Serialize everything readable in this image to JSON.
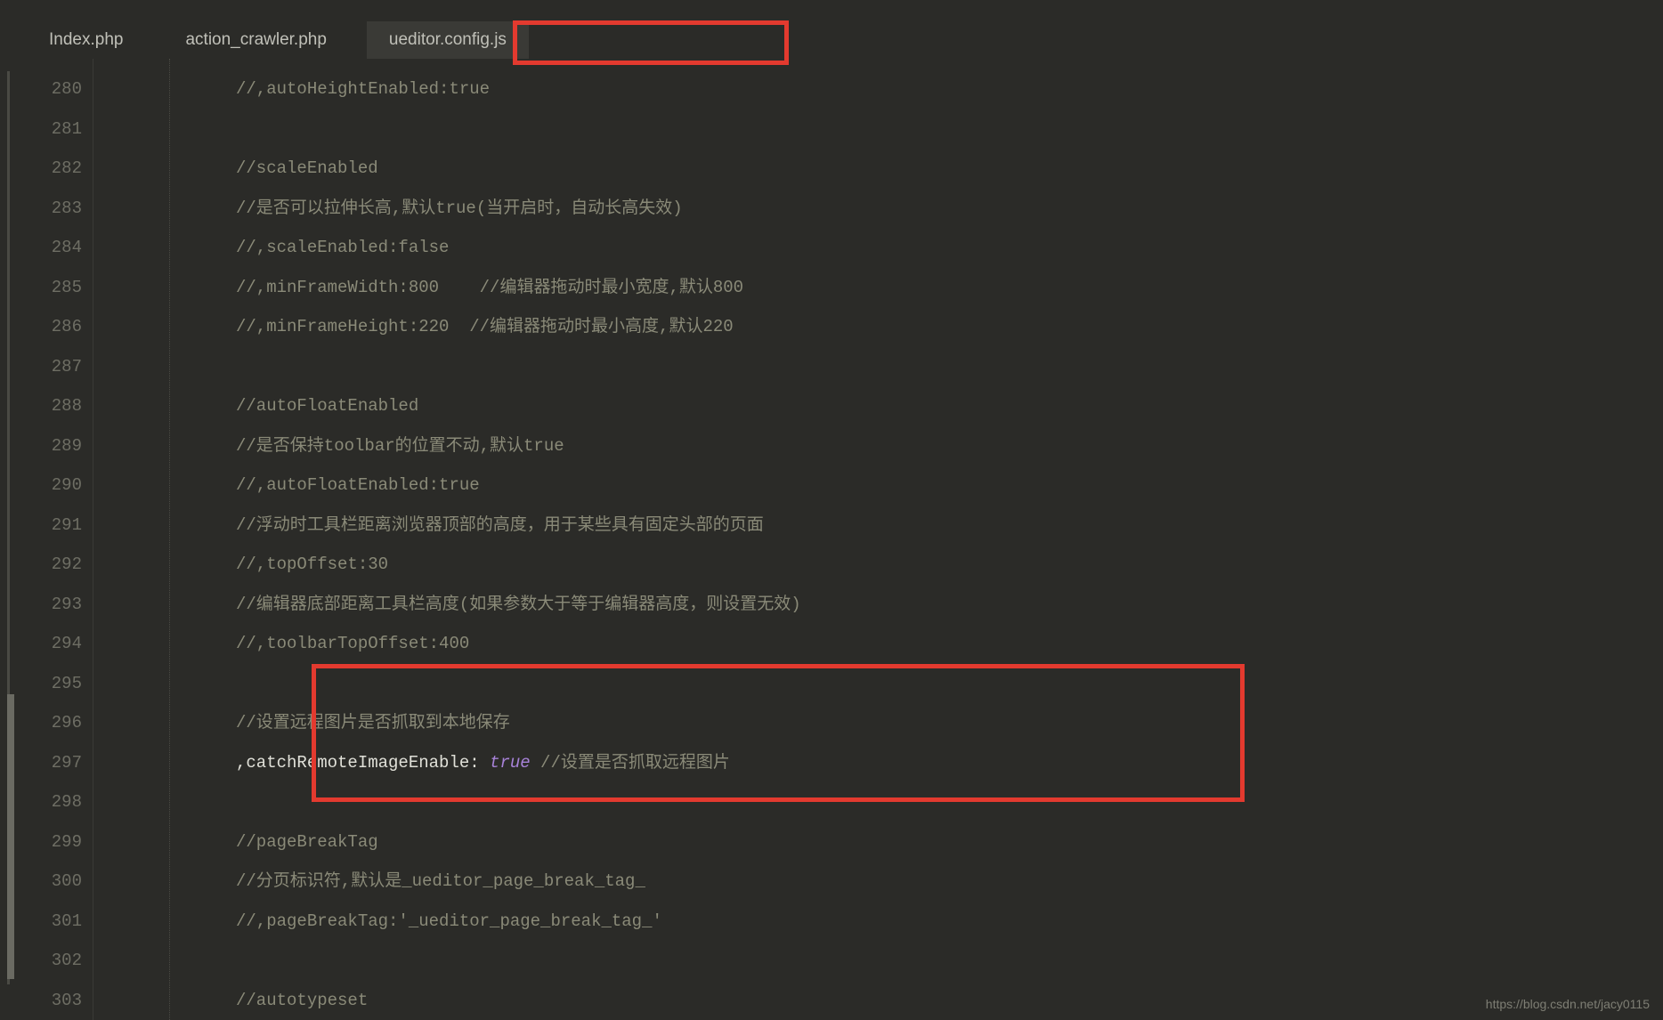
{
  "tabs": [
    {
      "label": "Index.php",
      "active": false
    },
    {
      "label": "action_crawler.php",
      "active": false
    },
    {
      "label": "ueditor.config.js",
      "active": true
    }
  ],
  "lines": [
    {
      "num": "280",
      "segments": [
        {
          "cls": "comment",
          "text": "//,autoHeightEnabled:true"
        }
      ]
    },
    {
      "num": "281",
      "segments": []
    },
    {
      "num": "282",
      "segments": [
        {
          "cls": "comment",
          "text": "//scaleEnabled"
        }
      ]
    },
    {
      "num": "283",
      "segments": [
        {
          "cls": "comment",
          "text": "//是否可以拉伸长高,默认true(当开启时，自动长高失效)"
        }
      ]
    },
    {
      "num": "284",
      "segments": [
        {
          "cls": "comment",
          "text": "//,scaleEnabled:false"
        }
      ]
    },
    {
      "num": "285",
      "segments": [
        {
          "cls": "comment",
          "text": "//,minFrameWidth:800    //编辑器拖动时最小宽度,默认800"
        }
      ]
    },
    {
      "num": "286",
      "segments": [
        {
          "cls": "comment",
          "text": "//,minFrameHeight:220  //编辑器拖动时最小高度,默认220"
        }
      ]
    },
    {
      "num": "287",
      "segments": []
    },
    {
      "num": "288",
      "segments": [
        {
          "cls": "comment",
          "text": "//autoFloatEnabled"
        }
      ]
    },
    {
      "num": "289",
      "segments": [
        {
          "cls": "comment",
          "text": "//是否保持toolbar的位置不动,默认true"
        }
      ]
    },
    {
      "num": "290",
      "segments": [
        {
          "cls": "comment",
          "text": "//,autoFloatEnabled:true"
        }
      ]
    },
    {
      "num": "291",
      "segments": [
        {
          "cls": "comment",
          "text": "//浮动时工具栏距离浏览器顶部的高度，用于某些具有固定头部的页面"
        }
      ]
    },
    {
      "num": "292",
      "segments": [
        {
          "cls": "comment",
          "text": "//,topOffset:30"
        }
      ]
    },
    {
      "num": "293",
      "segments": [
        {
          "cls": "comment",
          "text": "//编辑器底部距离工具栏高度(如果参数大于等于编辑器高度，则设置无效)"
        }
      ]
    },
    {
      "num": "294",
      "segments": [
        {
          "cls": "comment",
          "text": "//,toolbarTopOffset:400"
        }
      ]
    },
    {
      "num": "295",
      "segments": []
    },
    {
      "num": "296",
      "segments": [
        {
          "cls": "comment",
          "text": "//设置远程图片是否抓取到本地保存"
        }
      ]
    },
    {
      "num": "297",
      "segments": [
        {
          "cls": "plain",
          "text": ",catchRemoteImageEnable: "
        },
        {
          "cls": "keyword",
          "text": "true"
        },
        {
          "cls": "comment",
          "text": " //设置是否抓取远程图片"
        }
      ]
    },
    {
      "num": "298",
      "segments": []
    },
    {
      "num": "299",
      "segments": [
        {
          "cls": "comment",
          "text": "//pageBreakTag"
        }
      ]
    },
    {
      "num": "300",
      "segments": [
        {
          "cls": "comment",
          "text": "//分页标识符,默认是_ueditor_page_break_tag_"
        }
      ]
    },
    {
      "num": "301",
      "segments": [
        {
          "cls": "comment",
          "text": "//,pageBreakTag:'_ueditor_page_break_tag_'"
        }
      ]
    },
    {
      "num": "302",
      "segments": []
    },
    {
      "num": "303",
      "segments": [
        {
          "cls": "comment",
          "text": "//autotypeset"
        }
      ]
    }
  ],
  "watermark": "https://blog.csdn.net/jacy0115"
}
